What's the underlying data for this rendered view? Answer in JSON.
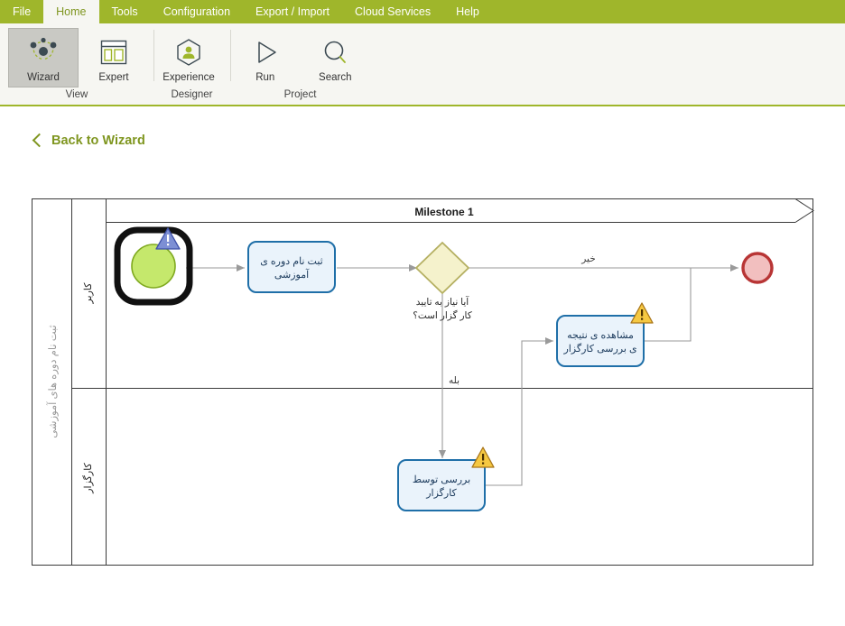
{
  "menu": {
    "tabs": [
      {
        "label": "File",
        "active": false
      },
      {
        "label": "Home",
        "active": true
      },
      {
        "label": "Tools",
        "active": false
      },
      {
        "label": "Configuration",
        "active": false
      },
      {
        "label": "Export / Import",
        "active": false
      },
      {
        "label": "Cloud Services",
        "active": false
      },
      {
        "label": "Help",
        "active": false
      }
    ]
  },
  "ribbon": {
    "groups": [
      {
        "label": "View",
        "buttons": [
          {
            "label": "Wizard",
            "icon": "network-nodes-icon",
            "selected": true
          },
          {
            "label": "Expert",
            "icon": "panels-layout-icon",
            "selected": false
          }
        ]
      },
      {
        "label": "Designer",
        "buttons": [
          {
            "label": "Experience",
            "icon": "person-hexagon-icon",
            "selected": false
          }
        ]
      },
      {
        "label": "Project",
        "buttons": [
          {
            "label": "Run",
            "icon": "play-triangle-icon",
            "selected": false
          },
          {
            "label": "Search",
            "icon": "magnifier-icon",
            "selected": false
          }
        ]
      }
    ]
  },
  "back_link": {
    "label": "Back to Wizard",
    "icon": "chevron-left-icon"
  },
  "diagram": {
    "pool_label": "ثبت نام دوره های آموزشی",
    "milestone_title": "Milestone 1",
    "lanes": [
      {
        "label": "کاربر"
      },
      {
        "label": "کارگزار"
      }
    ],
    "nodes": [
      {
        "id": "start",
        "type": "start-event",
        "label": "",
        "selected": true,
        "badge": "info-warning-badge",
        "fill": "#c5e86c",
        "stroke": "#7fa91f"
      },
      {
        "id": "task-register",
        "type": "task",
        "label_line1": "ثبت نام دوره ی",
        "label_line2": "آموزشی",
        "badge": "",
        "fill": "#eaf3fb",
        "stroke": "#1f6fa8"
      },
      {
        "id": "gateway",
        "type": "exclusive-gateway",
        "label_line1": "آیا نیاز به تایید",
        "label_line2": "کار گزار است؟",
        "fill": "#f5f2cc",
        "stroke": "#b5b062"
      },
      {
        "id": "task-view-result",
        "type": "task",
        "label_line1": "مشاهده ی نتیجه",
        "label_line2": "ی بررسی کارگزار",
        "badge": "warning-badge",
        "fill": "#eaf3fb",
        "stroke": "#1f6fa8"
      },
      {
        "id": "task-review",
        "type": "task",
        "label_line1": "بررسی توسط",
        "label_line2": "کارگزار",
        "badge": "warning-badge",
        "fill": "#eaf3fb",
        "stroke": "#1f6fa8"
      },
      {
        "id": "end",
        "type": "end-event",
        "label": "",
        "fill": "#f2bfbf",
        "stroke": "#b83535"
      }
    ],
    "flow_labels": {
      "no": "خیر",
      "yes": "بله"
    }
  },
  "colors": {
    "brand_green": "#9fb62b",
    "brand_green_text": "#7f9620",
    "ribbon_bg": "#f6f6f2",
    "task_fill": "#eaf3fb",
    "task_stroke": "#1f6fa8",
    "gateway_fill": "#f5f2cc",
    "gateway_stroke": "#b5b062",
    "start_fill": "#c5e86c",
    "end_fill": "#f2bfbf",
    "end_stroke": "#b83535",
    "connector": "#8c8c8c"
  }
}
